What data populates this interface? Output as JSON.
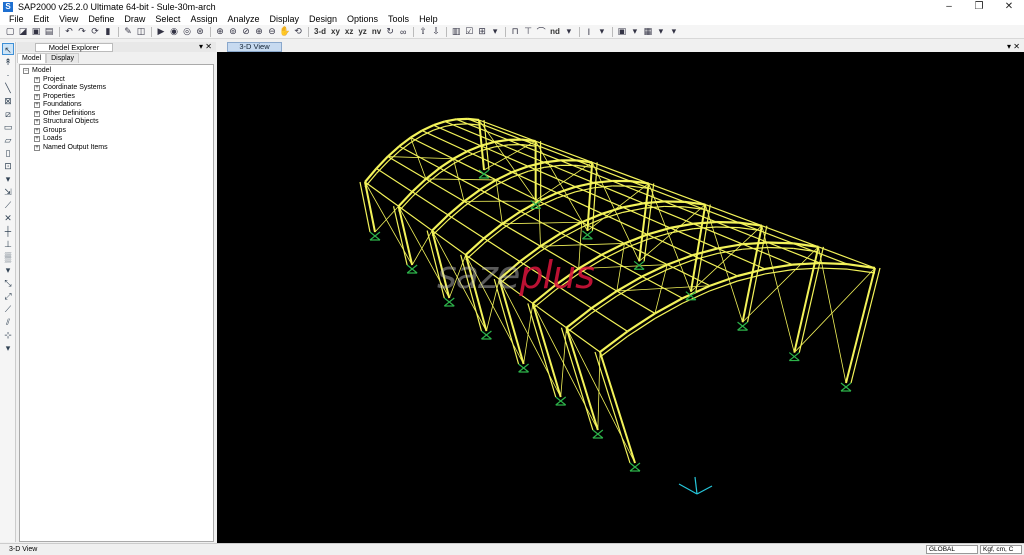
{
  "app": {
    "title": "SAP2000 v25.2.0 Ultimate 64-bit - Sule-30m-arch",
    "icon": "S"
  },
  "window_controls": {
    "minimize": "–",
    "restore": "❐",
    "close": "✕"
  },
  "menu": [
    "File",
    "Edit",
    "View",
    "Define",
    "Draw",
    "Select",
    "Assign",
    "Analyze",
    "Display",
    "Design",
    "Options",
    "Tools",
    "Help"
  ],
  "toolbar": {
    "view_3d": "3-d",
    "view_xy": "xy",
    "view_xz": "xz",
    "view_yz": "yz",
    "view_nv": "nv",
    "view_nd": "nd"
  },
  "explorer": {
    "title": "Model Explorer",
    "tabs": [
      "Model",
      "Display"
    ],
    "root": "Model",
    "children": [
      "Project",
      "Coordinate Systems",
      "Properties",
      "Foundations",
      "Other Definitions",
      "Structural Objects",
      "Groups",
      "Loads",
      "Named Output Items"
    ]
  },
  "view": {
    "tab_label": "3-D View",
    "background": "#000000",
    "frame_color": "#f3f35a",
    "support_color": "#2db34a"
  },
  "watermark": {
    "part1": "saze",
    "part2": "plus"
  },
  "status": {
    "left": "3-D View",
    "coord_system": "GLOBAL",
    "units": "Kgf, cm, C"
  }
}
